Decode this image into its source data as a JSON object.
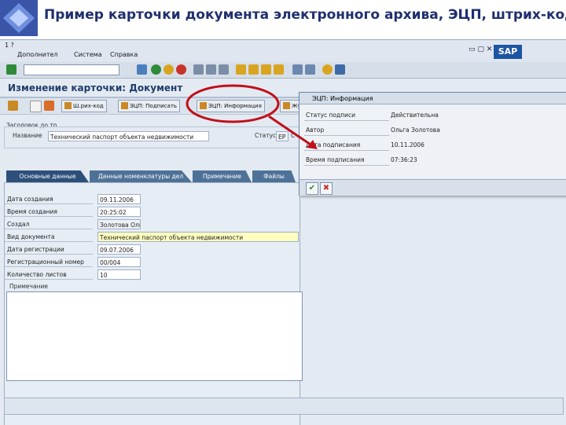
{
  "slide": {
    "title": "Пример карточки документа электронного архива, ЭЦП, штрих-код"
  },
  "sap": {
    "menu_prefix": "1 ?",
    "menu": [
      "Дополнител",
      "Система",
      "Справка"
    ],
    "logo_text": "SAP",
    "screen_title": "Изменение карточки: Документ",
    "app_toolbar": [
      "Ш.рих-код",
      "ЭЦП: Подписать",
      "ЭЦП: Информация",
      "Журнал досту"
    ]
  },
  "header_group": {
    "title": "Заголовок до  то",
    "name_label": "Название",
    "name_value": "Технический паспорт объекта недвижимости",
    "status_label": "Статус",
    "status_value": "ЕР",
    "status_short": "С"
  },
  "tabs": [
    "Основные данные",
    "Данные номенклатуры дел",
    "Примечание",
    "Файлы"
  ],
  "fields": [
    {
      "label": "Дата создания",
      "value": "09.11.2006",
      "style": "white"
    },
    {
      "label": "Время создания",
      "value": "20:25:02",
      "style": "white"
    },
    {
      "label": "Создал",
      "value": "Золотова Ольга",
      "style": "ro"
    },
    {
      "label": "Вид документа",
      "value": "Технический паспорт объекта недвижимости",
      "style": "yellow"
    },
    {
      "label": "Дата регистрации",
      "value": "09.07.2006",
      "style": "white"
    },
    {
      "label": "Регистрационный номер",
      "value": "00/004",
      "style": "white"
    },
    {
      "label": "Количество листов",
      "value": "10",
      "style": "white"
    }
  ],
  "notes_label": "Примечание",
  "popup": {
    "title": "ЭЦП: Информация",
    "rows": [
      {
        "label": "Статус подписи",
        "value": "Действительна"
      },
      {
        "label": "Автор",
        "value": "Ольга Золотова"
      },
      {
        "label": "Дата подписания",
        "value": "10.11.2006"
      },
      {
        "label": "Время подписания",
        "value": "07:36:23"
      }
    ],
    "ok_icon": "✔",
    "cancel_icon": "✖"
  },
  "colors": {
    "annotation": "#c0101a",
    "tab": "#4e7197",
    "tab_active": "#2d4f79"
  },
  "icons": [
    "check-icon",
    "back-icon",
    "exit-icon",
    "cancel-icon",
    "print-icon",
    "find-icon",
    "new-session-icon",
    "help-icon",
    "layout-icon"
  ]
}
